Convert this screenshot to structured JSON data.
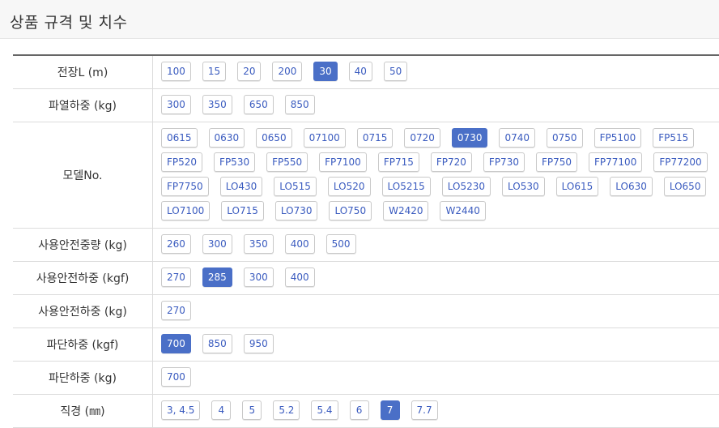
{
  "header": {
    "title": "상품 규격 및 치수"
  },
  "rows": [
    {
      "label": "전장L (m)",
      "options": [
        "100",
        "15",
        "20",
        "200",
        "30",
        "40",
        "50"
      ],
      "selected": "30"
    },
    {
      "label": "파열하중 (kg)",
      "options": [
        "300",
        "350",
        "650",
        "850"
      ],
      "selected": ""
    },
    {
      "label": "모델No.",
      "options": [
        "0615",
        "0630",
        "0650",
        "07100",
        "0715",
        "0720",
        "0730",
        "0740",
        "0750",
        "FP5100",
        "FP515",
        "FP520",
        "FP530",
        "FP550",
        "FP7100",
        "FP715",
        "FP720",
        "FP730",
        "FP750",
        "FP77100",
        "FP77200",
        "FP7750",
        "LO430",
        "LO515",
        "LO520",
        "LO5215",
        "LO5230",
        "LO530",
        "LO615",
        "LO630",
        "LO650",
        "LO7100",
        "LO715",
        "LO730",
        "LO750",
        "W2420",
        "W2440"
      ],
      "selected": "0730"
    },
    {
      "label": "사용안전중량 (kg)",
      "options": [
        "260",
        "300",
        "350",
        "400",
        "500"
      ],
      "selected": ""
    },
    {
      "label": "사용안전하중 (kgf)",
      "options": [
        "270",
        "285",
        "300",
        "400"
      ],
      "selected": "285"
    },
    {
      "label": "사용안전하중 (kg)",
      "options": [
        "270"
      ],
      "selected": ""
    },
    {
      "label": "파단하중 (kgf)",
      "options": [
        "700",
        "850",
        "950"
      ],
      "selected": "700"
    },
    {
      "label": "파단하중 (kg)",
      "options": [
        "700"
      ],
      "selected": ""
    },
    {
      "label": "직경 (㎜)",
      "options": [
        "3, 4.5",
        "4",
        "5",
        "5.2",
        "5.4",
        "6",
        "7",
        "7.7"
      ],
      "selected": "7"
    }
  ]
}
